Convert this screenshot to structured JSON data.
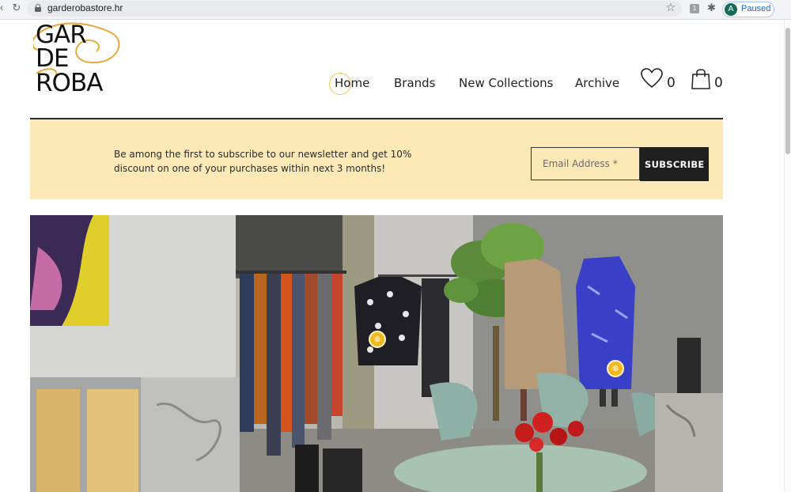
{
  "browser": {
    "url": "garderobastore.hr",
    "profile_initial": "A",
    "profile_status": "Paused",
    "extension_label": "1"
  },
  "logo": {
    "lines": [
      "GAR",
      "DE",
      "ROBA"
    ]
  },
  "nav": {
    "items": [
      "Home",
      "Brands",
      "New Collections",
      "Archive"
    ],
    "wishlist_count": "0",
    "cart_count": "0"
  },
  "newsletter": {
    "message": "Be among the first to subscribe to our newsletter and get 10% discount on one of your purchases within next 3 months!",
    "email_placeholder": "Email Address *",
    "button_label": "SUBSCRIBE"
  },
  "colors": {
    "accent": "#f3c74e",
    "banner_bg": "#fde9b6",
    "button_bg": "#1f1f1f",
    "hotspot": "#f2b91f"
  },
  "hero": {
    "hotspot_icon": "bag-icon",
    "hotspot_count": 2
  }
}
